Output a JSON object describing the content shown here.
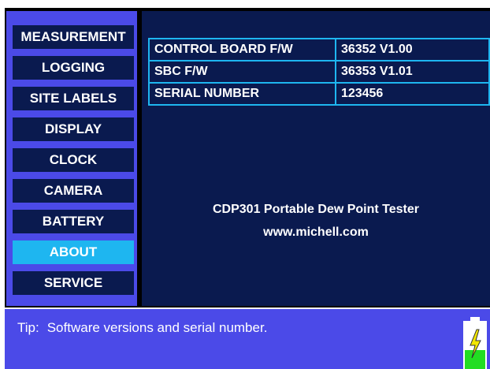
{
  "menu": {
    "items": [
      {
        "label": "MEASUREMENT",
        "active": false
      },
      {
        "label": "LOGGING",
        "active": false
      },
      {
        "label": "SITE LABELS",
        "active": false
      },
      {
        "label": "DISPLAY",
        "active": false
      },
      {
        "label": "CLOCK",
        "active": false
      },
      {
        "label": "CAMERA",
        "active": false
      },
      {
        "label": "BATTERY",
        "active": false
      },
      {
        "label": "ABOUT",
        "active": true
      },
      {
        "label": "SERVICE",
        "active": false
      }
    ]
  },
  "about": {
    "rows": [
      {
        "key": "CONTROL BOARD F/W",
        "value": "36352 V1.00"
      },
      {
        "key": "SBC F/W",
        "value": "36353 V1.01"
      },
      {
        "key": "SERIAL NUMBER",
        "value": "123456"
      }
    ],
    "product_name": "CDP301 Portable Dew Point Tester",
    "website": "www.michell.com"
  },
  "tip": {
    "prefix": "Tip:",
    "text": "Software versions and serial number."
  },
  "battery": {
    "icon": "battery-charging-icon",
    "fill_color": "#22DD22",
    "bolt_color": "#F2E600"
  },
  "colors": {
    "sidebar_bg": "#4B4AE8",
    "button_bg": "#0A1A4F",
    "active_button_bg": "#1EB6F0",
    "main_bg": "#0A1A4F",
    "table_border": "#1EB6F0"
  }
}
